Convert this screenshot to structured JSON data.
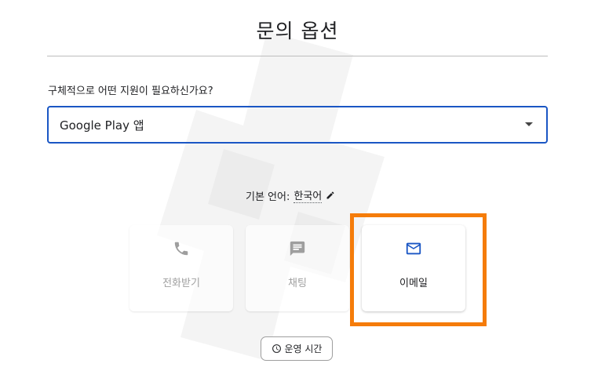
{
  "page": {
    "title": "문의 옵션",
    "question": "구체적으로 어떤 지원이 필요하신가요?"
  },
  "select": {
    "value": "Google Play 앱"
  },
  "language": {
    "label": "기본 언어:",
    "value": "한국어"
  },
  "options": [
    {
      "label": "전화받기",
      "icon": "phone-icon",
      "state": "disabled"
    },
    {
      "label": "채팅",
      "icon": "chat-icon",
      "state": "disabled"
    },
    {
      "label": "이메일",
      "icon": "mail-icon",
      "state": "enabled"
    }
  ],
  "hours_button": {
    "label": "운영 시간",
    "icon": "clock-icon"
  },
  "colors": {
    "accent": "#1a56c4",
    "highlight": "#f57c0a",
    "disabled_text": "#a0a0a0"
  }
}
